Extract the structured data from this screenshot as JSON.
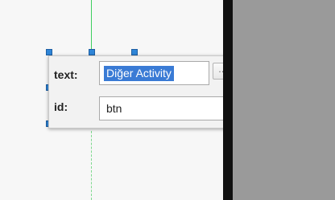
{
  "properties_popup": {
    "text_label": "text:",
    "text_value": "Diğer Activity",
    "ellipsis_label": "...",
    "id_label": "id:",
    "id_value": "btn"
  },
  "colors": {
    "selection": "#3a7bd5",
    "guide": "#3fcf5f",
    "handle": "#2f86d8",
    "right_panel": "#9a9a9a"
  }
}
